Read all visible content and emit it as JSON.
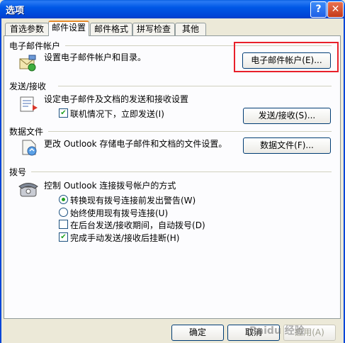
{
  "window": {
    "title": "选项",
    "help": "?",
    "close": "✕"
  },
  "tabs": [
    "首选参数",
    "邮件设置",
    "邮件格式",
    "拼写检查",
    "其他"
  ],
  "sections": {
    "accounts": {
      "title": "电子邮件帐户",
      "desc": "设置电子邮件帐户和目录。",
      "button": "电子邮件帐户(E)..."
    },
    "send_receive": {
      "title": "发送/接收",
      "desc": "设定电子邮件及文档的发送和接收设置",
      "checkbox": "联机情况下，立即发送(I)",
      "checkbox_checked": true,
      "button": "发送/接收(S)..."
    },
    "data_files": {
      "title": "数据文件",
      "desc": "更改 Outlook 存储电子邮件和文档的文件设置。",
      "button": "数据文件(F)..."
    },
    "dialup": {
      "title": "拨号",
      "desc": "控制 Outlook 连接拨号帐户的方式",
      "radio1": "转换现有拨号连接前发出警告(W)",
      "radio1_selected": true,
      "radio2": "始终使用现有拨号连接(U)",
      "radio2_selected": false,
      "check1": "在后台发送/接收期间，自动拨号(D)",
      "check1_checked": false,
      "check2": "完成手动发送/接收后挂断(H)",
      "check2_checked": true
    }
  },
  "footer": {
    "ok": "确定",
    "cancel": "取消",
    "apply": "应用(A)"
  },
  "watermark": "Baidu 经验",
  "colors": {
    "title_bar": "#0054E3",
    "dialog_bg": "#ECE9D8",
    "highlight": "#E8202A",
    "check": "#21A121"
  }
}
